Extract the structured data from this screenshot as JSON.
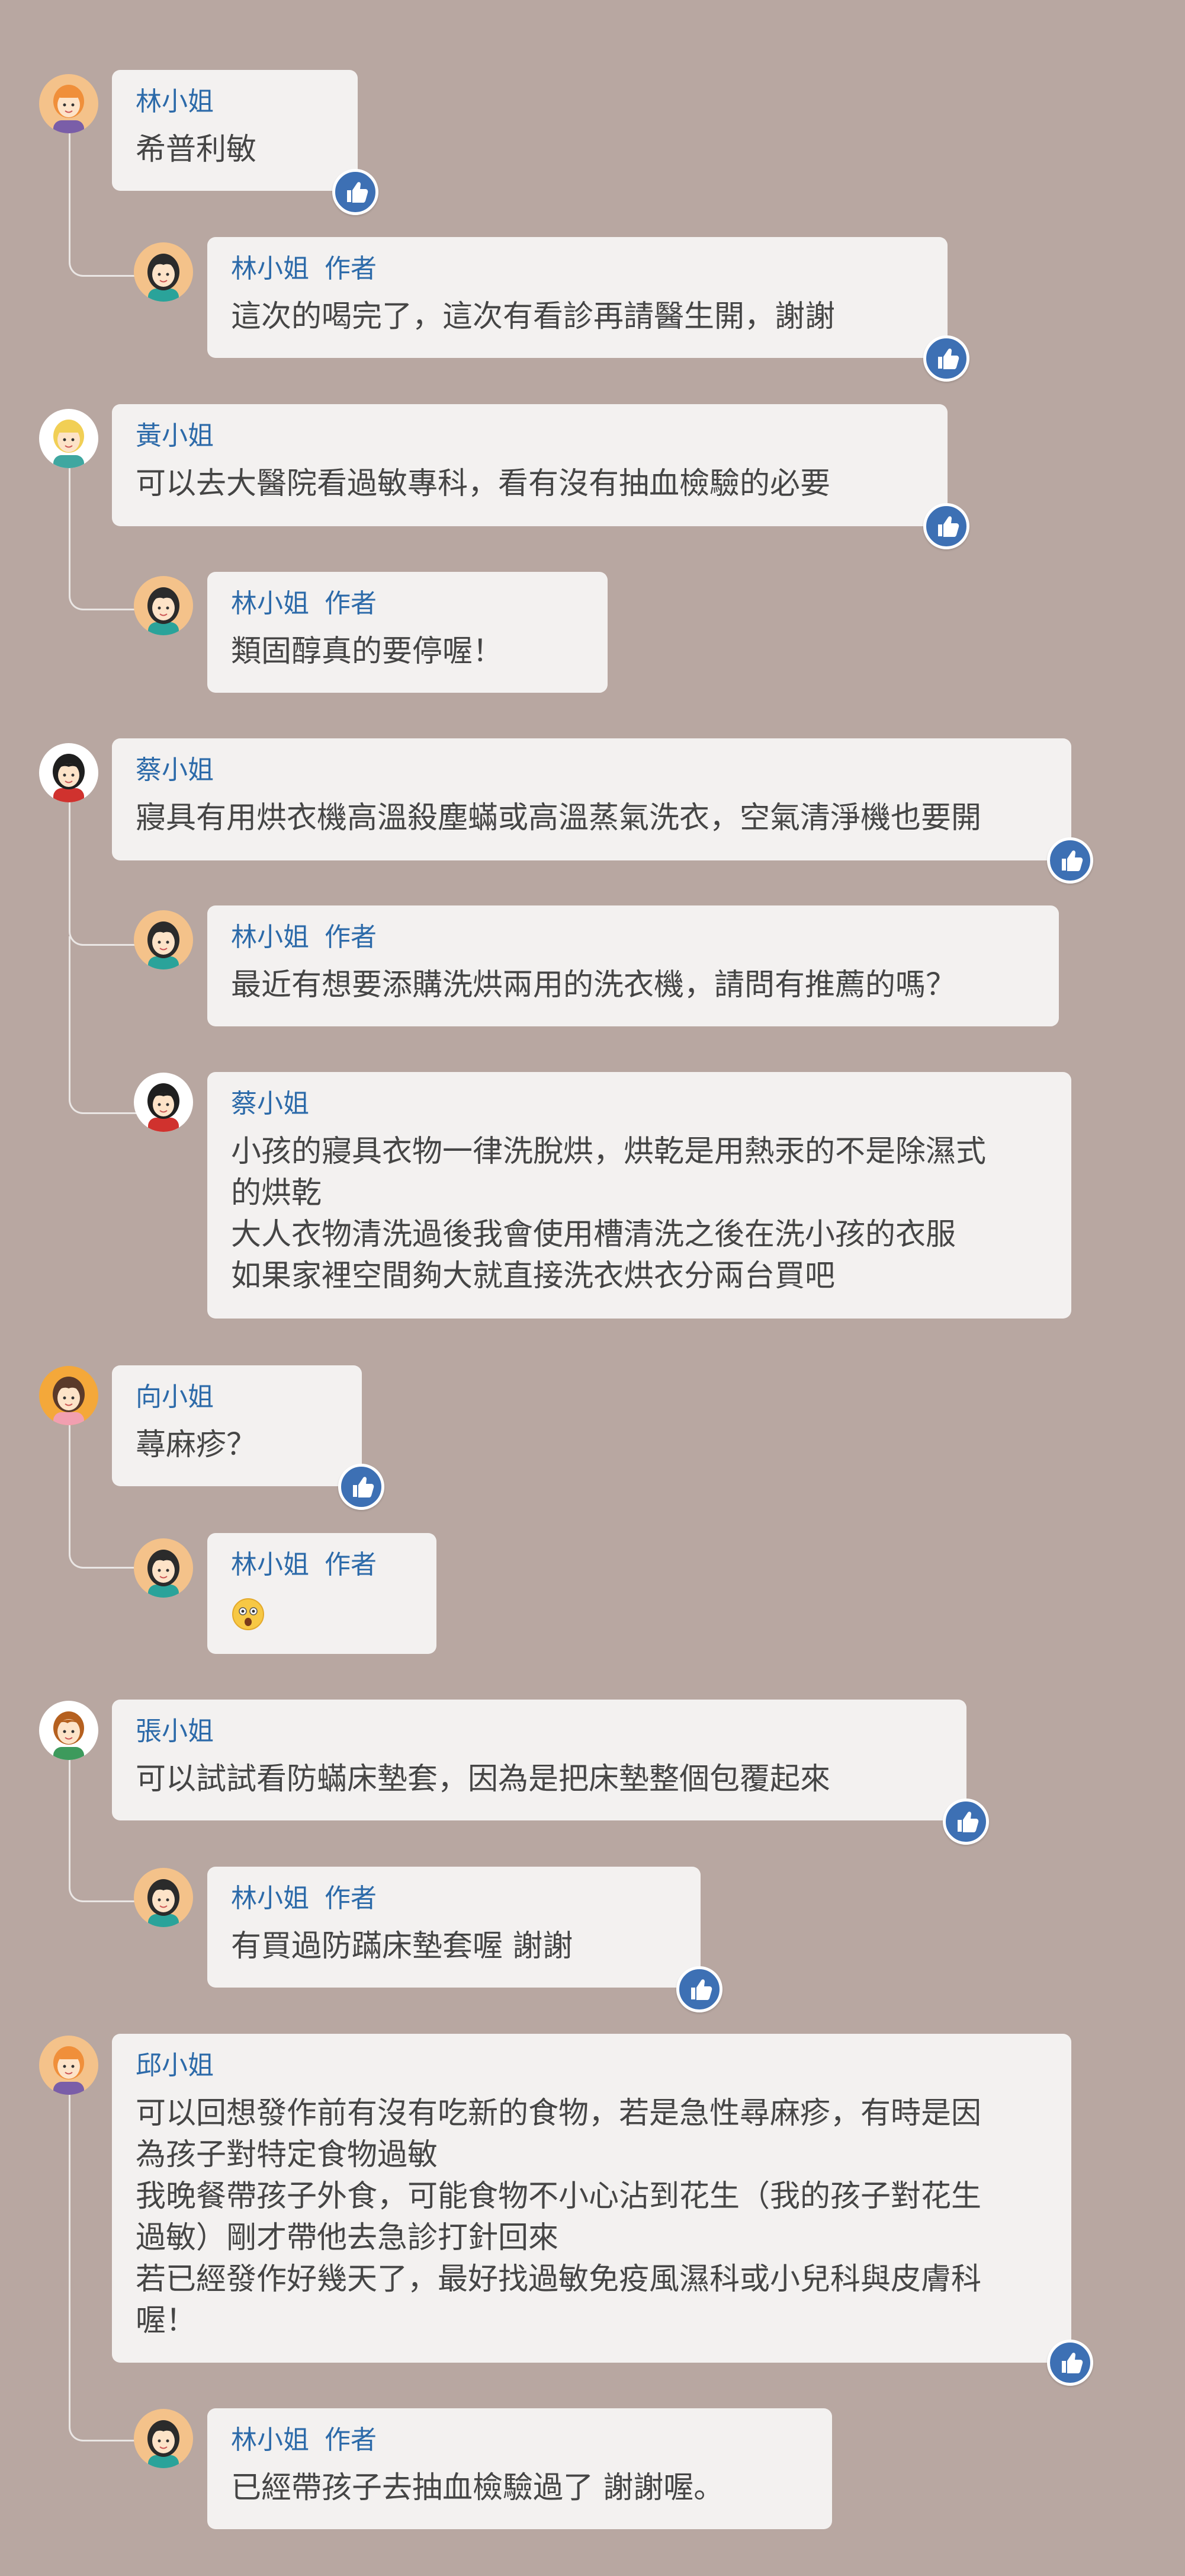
{
  "author_label": "作者",
  "comments": [
    {
      "name": "林小姐",
      "lines": [
        "希普利敏"
      ],
      "avatar": "woman-orange-hair-avatar-icon",
      "replies": [
        {
          "name": "林小姐",
          "is_author": true,
          "lines": [
            "這次的喝完了，這次有看診再請醫生開，謝謝"
          ],
          "avatar": "woman-black-hair-avatar-icon"
        }
      ]
    },
    {
      "name": "黃小姐",
      "lines": [
        "可以去大醫院看過敏專科，看有沒有抽血檢驗的必要"
      ],
      "avatar": "woman-blonde-hair-avatar-icon",
      "replies": [
        {
          "name": "林小姐",
          "is_author": true,
          "lines": [
            "類固醇真的要停喔！"
          ],
          "avatar": "woman-black-hair-avatar-icon"
        }
      ]
    },
    {
      "name": "蔡小姐",
      "lines": [
        "寢具有用烘衣機高溫殺塵蟎或高溫蒸氣洗衣，空氣清淨機也要開"
      ],
      "avatar": "woman-red-shirt-avatar-icon",
      "replies": [
        {
          "name": "林小姐",
          "is_author": true,
          "lines": [
            "最近有想要添購洗烘兩用的洗衣機，請問有推薦的嗎？"
          ],
          "avatar": "woman-black-hair-avatar-icon"
        },
        {
          "name": "蔡小姐",
          "is_author": false,
          "lines": [
            "小孩的寢具衣物一律洗脫烘，烘乾是用熱汞的不是除濕式",
            "的烘乾",
            "大人衣物清洗過後我會使用槽清洗之後在洗小孩的衣服",
            "如果家裡空間夠大就直接洗衣烘衣分兩台買吧"
          ],
          "avatar": "woman-red-shirt-avatar-icon"
        }
      ]
    },
    {
      "name": "向小姐",
      "lines": [
        "蕁麻疹？"
      ],
      "avatar": "woman-pink-shirt-avatar-icon",
      "replies": [
        {
          "name": "林小姐",
          "is_author": true,
          "lines": [
            ""
          ],
          "emoji": "astonished-face-emoji-icon",
          "avatar": "woman-black-hair-avatar-icon"
        }
      ]
    },
    {
      "name": "張小姐",
      "lines": [
        "可以試試看防蟎床墊套，因為是把床墊整個包覆起來"
      ],
      "avatar": "woman-brown-hair-avatar-icon",
      "replies": [
        {
          "name": "林小姐",
          "is_author": true,
          "lines": [
            "有買過防蹣床墊套喔 謝謝"
          ],
          "avatar": "woman-black-hair-avatar-icon"
        }
      ]
    },
    {
      "name": "邱小姐",
      "lines": [
        "可以回想發作前有沒有吃新的食物，若是急性尋麻疹，有時是因",
        "為孩子對特定食物過敏",
        "我晚餐帶孩子外食，可能食物不小心沾到花生（我的孩子對花生",
        "過敏）剛才帶他去急診打針回來",
        "若已經發作好幾天了，最好找過敏免疫風濕科或小兒科與皮膚科",
        "喔！"
      ],
      "avatar": "woman-orange-hair-avatar-icon",
      "replies": [
        {
          "name": "林小姐",
          "is_author": true,
          "lines": [
            "已經帶孩子去抽血檢驗過了 謝謝喔。"
          ],
          "avatar": "woman-black-hair-avatar-icon"
        }
      ]
    }
  ],
  "colors": {
    "background": "#b8a7a1",
    "bubble": "#f3f1f0",
    "name": "#2c6aa9",
    "text": "#454545",
    "like_button": "#3d70b4"
  },
  "like_icon": "thumbs-up-icon"
}
